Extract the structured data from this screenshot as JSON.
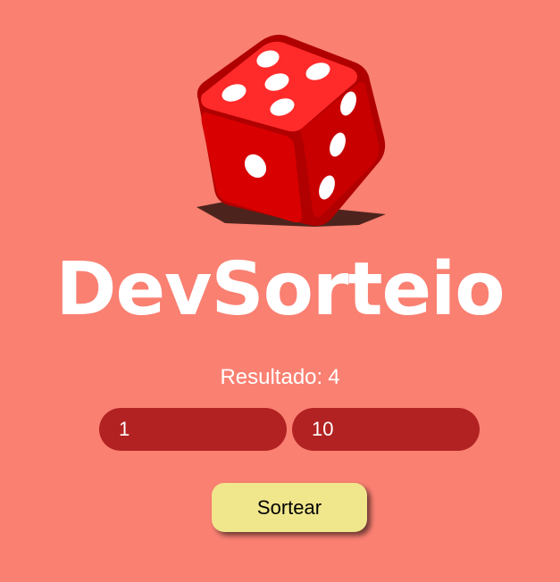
{
  "app": {
    "logo_text": "DevSorteio"
  },
  "result": {
    "label": "Resultado:",
    "value": "4"
  },
  "inputs": {
    "min_value": "1",
    "max_value": "10"
  },
  "actions": {
    "draw_label": "Sortear"
  },
  "colors": {
    "background": "#fa8072",
    "input_background": "#b22222",
    "button_background": "#f0e68c",
    "dice_red": "#e00000"
  },
  "icons": {
    "dice": "dice-icon"
  }
}
